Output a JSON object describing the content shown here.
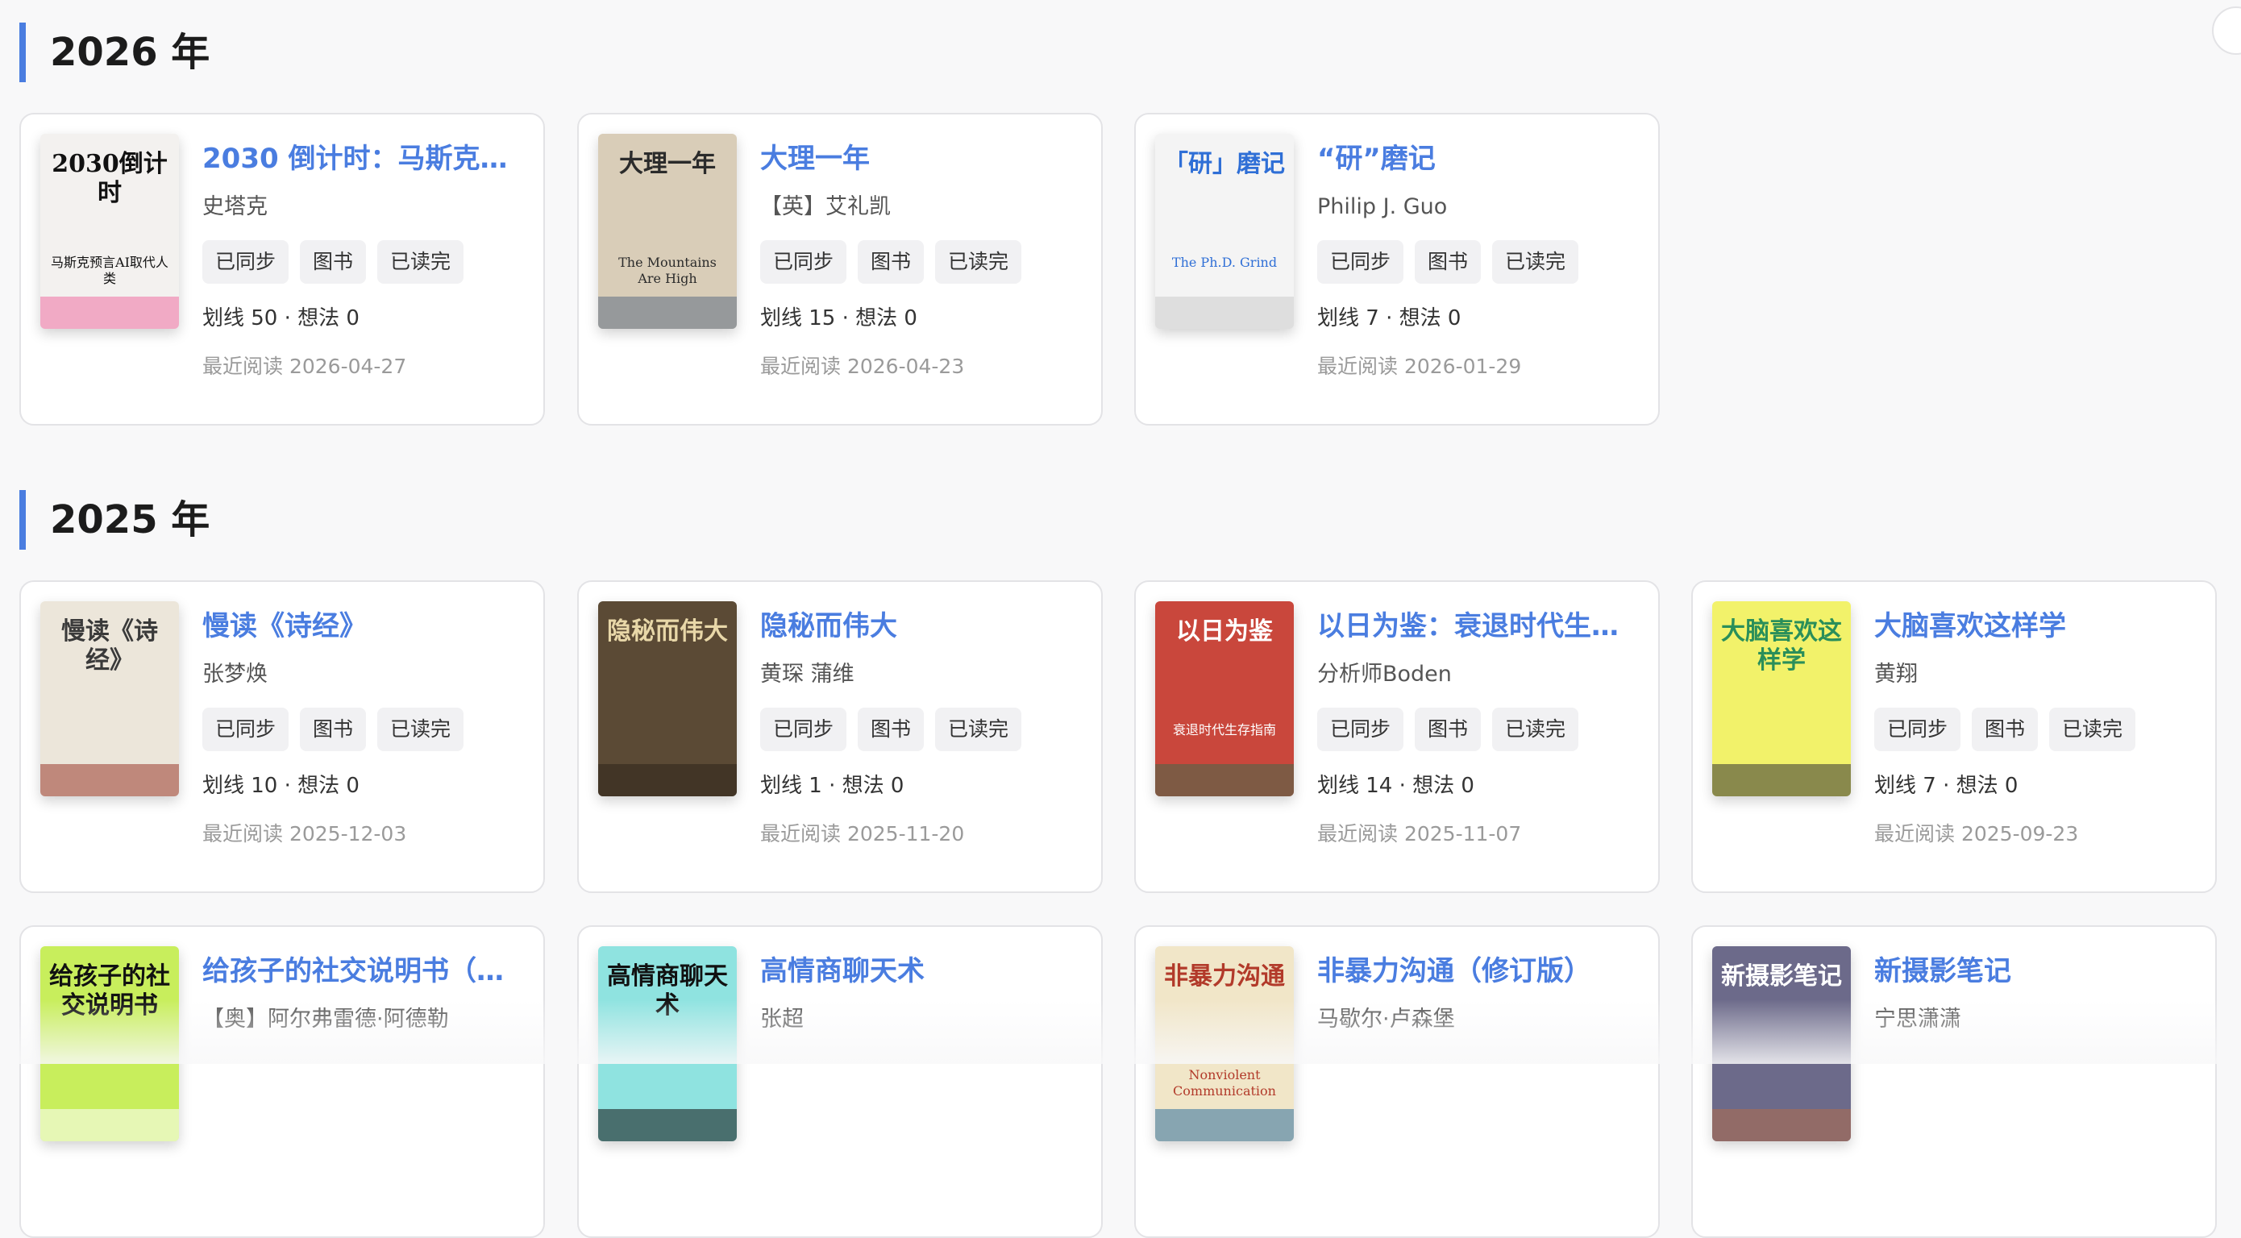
{
  "sections": [
    {
      "year": "2026 年",
      "books": [
        {
          "title": "2030 倒计时：马斯克预...",
          "author": "史塔克",
          "tags": [
            "已同步",
            "图书",
            "已读完"
          ],
          "stats": "划线 50 · 想法 0",
          "recent": "最近阅读 2026-04-27",
          "cover": {
            "title": "2030倒计时",
            "subtitle": "马斯克预言AI取代人类",
            "bg": "#f3f1ef",
            "fg": "#111111",
            "accent": "#ef6fa3"
          }
        },
        {
          "title": "大理一年",
          "author": "【英】艾礼凯",
          "tags": [
            "已同步",
            "图书",
            "已读完"
          ],
          "stats": "划线 15 · 想法 0",
          "recent": "最近阅读 2026-04-23",
          "cover": {
            "title": "大理一年",
            "subtitle": "The Mountains Are High",
            "bg": "#d9cdb8",
            "fg": "#2b2b2b",
            "accent": "#5f6f84"
          }
        },
        {
          "title": "“研”磨记",
          "author": "Philip J. Guo",
          "tags": [
            "已同步",
            "图书",
            "已读完"
          ],
          "stats": "划线 7 · 想法 0",
          "recent": "最近阅读 2026-01-29",
          "cover": {
            "title": "「研」磨记",
            "subtitle": "The Ph.D. Grind",
            "bg": "#f4f4f4",
            "fg": "#2f6fd6",
            "accent": "#cccccc"
          }
        }
      ]
    },
    {
      "year": "2025 年",
      "books": [
        {
          "title": "慢读《诗经》",
          "author": "张梦焕",
          "tags": [
            "已同步",
            "图书",
            "已读完"
          ],
          "stats": "划线 10 · 想法 0",
          "recent": "最近阅读 2025-12-03",
          "cover": {
            "title": "慢读《诗经》",
            "subtitle": "",
            "bg": "#ece6da",
            "fg": "#3a3a3a",
            "accent": "#9a3b2e"
          }
        },
        {
          "title": "隐秘而伟大",
          "author": "黄琛 蒲维",
          "tags": [
            "已同步",
            "图书",
            "已读完"
          ],
          "stats": "划线 1 · 想法 0",
          "recent": "最近阅读 2025-11-20",
          "cover": {
            "title": "隐秘而伟大",
            "subtitle": "",
            "bg": "#5b4a35",
            "fg": "#e8d7a8",
            "accent": "#2d241a"
          }
        },
        {
          "title": "以日为鉴：衰退时代生存...",
          "author": "分析师Boden",
          "tags": [
            "已同步",
            "图书",
            "已读完"
          ],
          "stats": "划线 14 · 想法 0",
          "recent": "最近阅读 2025-11-07",
          "cover": {
            "title": "以日为鉴",
            "subtitle": "衰退时代生存指南",
            "bg": "#c9473c",
            "fg": "#ffffff",
            "accent": "#3f6a4a"
          }
        },
        {
          "title": "大脑喜欢这样学",
          "author": "黄翔",
          "tags": [
            "已同步",
            "图书",
            "已读完"
          ],
          "stats": "划线 7 · 想法 0",
          "recent": "最近阅读 2025-09-23",
          "cover": {
            "title": "大脑喜欢这样学",
            "subtitle": "",
            "bg": "#f2f26a",
            "fg": "#2a8f5a",
            "accent": "#333333"
          }
        }
      ]
    },
    {
      "year": "",
      "books": [
        {
          "title": "给孩子的社交说明书（轻...",
          "author": "【奥】阿尔弗雷德·阿德勒",
          "tags": [],
          "stats": "",
          "recent": "",
          "cover": {
            "title": "给孩子的社交说明书",
            "subtitle": "",
            "bg": "#c8ee5c",
            "fg": "#111111",
            "accent": "#ffffff"
          }
        },
        {
          "title": "高情商聊天术",
          "author": "张超",
          "tags": [],
          "stats": "",
          "recent": "",
          "cover": {
            "title": "高情商聊天术",
            "subtitle": "",
            "bg": "#8fe3e0",
            "fg": "#111111",
            "accent": "#111111"
          }
        },
        {
          "title": "非暴力沟通（修订版）",
          "author": "马歇尔·卢森堡",
          "tags": [],
          "stats": "",
          "recent": "",
          "cover": {
            "title": "非暴力沟通",
            "subtitle": "Nonviolent Communication",
            "bg": "#f1e6c8",
            "fg": "#b23a2a",
            "accent": "#2f6f9f"
          }
        },
        {
          "title": "新摄影笔记",
          "author": "宁思潇潇",
          "tags": [],
          "stats": "",
          "recent": "",
          "cover": {
            "title": "新摄影笔记",
            "subtitle": "",
            "bg": "#6c6a8a",
            "fg": "#ffffff",
            "accent": "#b36b4a"
          }
        }
      ]
    }
  ]
}
